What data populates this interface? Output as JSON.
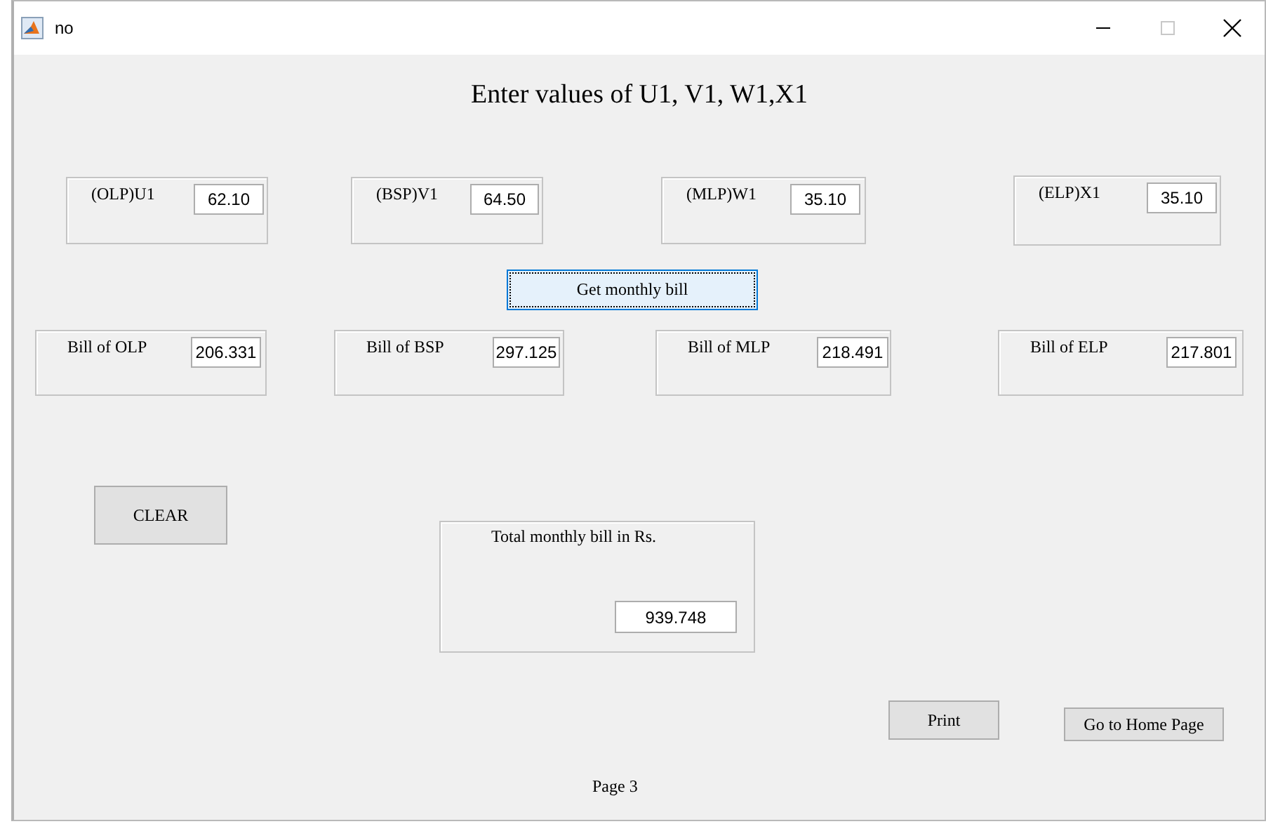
{
  "window": {
    "title": "no"
  },
  "heading": "Enter values of U1, V1, W1,X1",
  "inputs": [
    {
      "label": "(OLP)U1",
      "value": "62.10"
    },
    {
      "label": "(BSP)V1",
      "value": "64.50"
    },
    {
      "label": "(MLP)W1",
      "value": "35.10"
    },
    {
      "label": "(ELP)X1",
      "value": "35.10"
    }
  ],
  "get_bill_button": {
    "label": "Get monthly bill",
    "focused": true
  },
  "bills": [
    {
      "label": "Bill of OLP",
      "value": "206.331"
    },
    {
      "label": "Bill of BSP",
      "value": "297.125"
    },
    {
      "label": "Bill of MLP",
      "value": "218.491"
    },
    {
      "label": "Bill of ELP",
      "value": "217.801"
    }
  ],
  "clear_button": {
    "label": "CLEAR"
  },
  "total": {
    "label": "Total monthly bill in Rs.",
    "value": "939.748"
  },
  "print_button": {
    "label": "Print"
  },
  "home_button": {
    "label": "Go to Home Page"
  },
  "page_label": "Page 3"
}
